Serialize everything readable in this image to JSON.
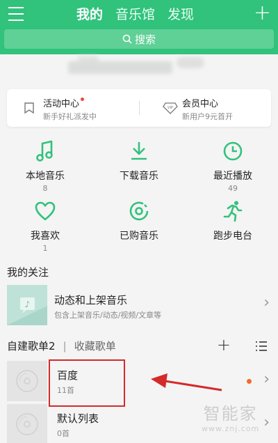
{
  "colors": {
    "brand": "#31c27c",
    "highlight": "#d42a2a",
    "dot_red": "#e74c3c",
    "dot_orange": "#ef6c2a"
  },
  "header": {
    "tabs": [
      {
        "label": "我的",
        "active": true
      },
      {
        "label": "音乐馆",
        "active": false
      },
      {
        "label": "发现",
        "active": false
      }
    ],
    "add_label": "+",
    "search_placeholder": "搜索",
    "icons": {
      "menu": "menu-icon",
      "search": "search-icon"
    }
  },
  "promo": [
    {
      "title": "活动中心",
      "subtitle": "新手好礼派发中",
      "icon": "bookmark-icon",
      "new_dot": true
    },
    {
      "title": "会员中心",
      "subtitle": "新用户9元首开",
      "icon": "vip-diamond-icon",
      "new_dot": false
    }
  ],
  "grid": [
    {
      "label": "本地音乐",
      "count": "8",
      "icon": "music-note-icon"
    },
    {
      "label": "下载音乐",
      "count": "",
      "icon": "download-icon"
    },
    {
      "label": "最近播放",
      "count": "49",
      "icon": "clock-icon"
    },
    {
      "label": "我喜欢",
      "count": "1",
      "icon": "heart-icon"
    },
    {
      "label": "已购音乐",
      "count": "",
      "icon": "purchased-disc-icon"
    },
    {
      "label": "跑步电台",
      "count": "",
      "icon": "running-icon"
    }
  ],
  "follow": {
    "section_title": "我的关注",
    "title": "动态和上架音乐",
    "subtitle": "包含上架音乐/动态/视频/文章等",
    "chevron": "›"
  },
  "playlists": {
    "tab_self": "自建歌单2",
    "separator": "|",
    "tab_collected": "收藏歌单",
    "add_label": "+",
    "items": [
      {
        "name": "百度",
        "count": "11首",
        "chevron": "›"
      },
      {
        "name": "默认列表",
        "count": "0首",
        "chevron": "›"
      }
    ]
  },
  "watermark": {
    "cn": "智能家",
    "en": "www.znj.com"
  }
}
